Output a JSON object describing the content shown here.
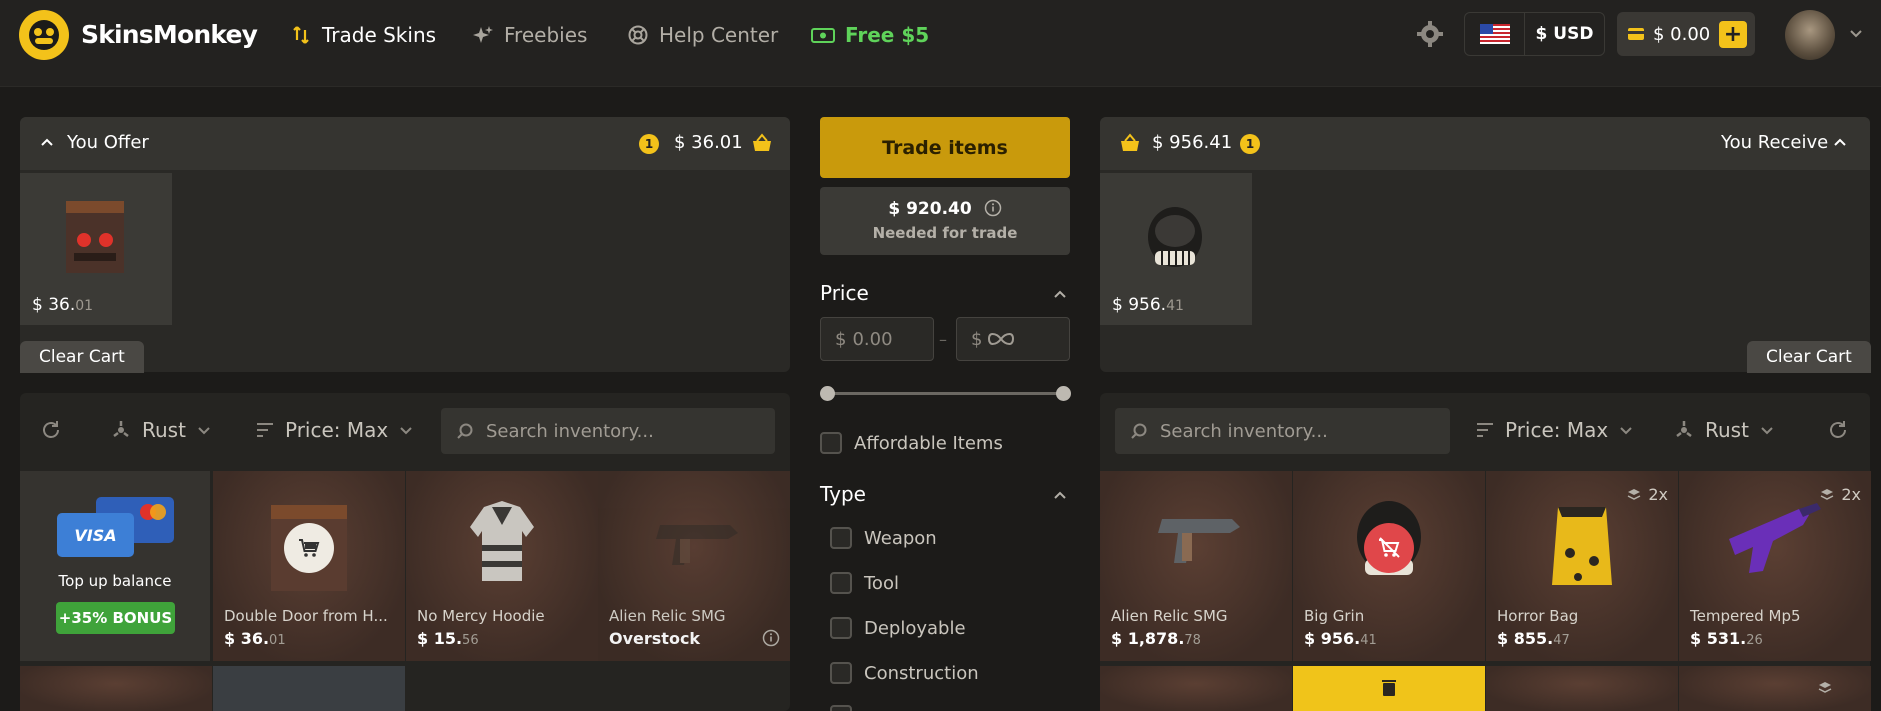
{
  "brand": {
    "name": "SkinsMonkey",
    "accent": "#f3c21a"
  },
  "nav": [
    {
      "label": "Trade Skins",
      "icon": "trade-arrows-icon"
    },
    {
      "label": "Freebies",
      "icon": "sparkles-icon"
    },
    {
      "label": "Help Center",
      "icon": "lifebuoy-icon"
    },
    {
      "label": "Free $5",
      "icon": "cash-icon"
    }
  ],
  "header": {
    "currency": "$ USD",
    "balance": "$ 0.00",
    "add_label": "+"
  },
  "offer": {
    "title": "You Offer",
    "count": "1",
    "total": "$ 36.01",
    "items": [
      {
        "price_main": "$ 36.",
        "price_cents": "01"
      }
    ],
    "clear_label": "Clear Cart"
  },
  "receive": {
    "title": "You Receive",
    "count": "1",
    "total": "$ 956.41",
    "items": [
      {
        "price_main": "$ 956.",
        "price_cents": "41"
      }
    ],
    "clear_label": "Clear Cart"
  },
  "trade": {
    "button_label": "Trade items",
    "needed_value": "$ 920.40",
    "needed_label": "Needed for trade"
  },
  "filters": {
    "price_title": "Price",
    "price_min_symbol": "$",
    "price_min_placeholder": "0.00",
    "price_sep": "–",
    "price_max_symbol": "$",
    "affordable_label": "Affordable Items",
    "type_title": "Type",
    "types": [
      "Weapon",
      "Tool",
      "Deployable",
      "Construction"
    ]
  },
  "left_toolbar": {
    "game": "Rust",
    "sort": "Price: Max",
    "search_placeholder": "Search inventory..."
  },
  "right_toolbar": {
    "search_placeholder": "Search inventory...",
    "sort": "Price: Max",
    "game": "Rust"
  },
  "topup": {
    "label": "Top up balance",
    "card_label": "VISA",
    "bonus": "+35% BONUS"
  },
  "left_items": [
    {
      "name": "Double Door from H...",
      "price_main": "$ 36.",
      "price_cents": "01"
    },
    {
      "name": "No Mercy Hoodie",
      "price_main": "$ 15.",
      "price_cents": "56"
    },
    {
      "name": "Alien Relic SMG",
      "status": "Overstock"
    }
  ],
  "right_items": [
    {
      "name": "Alien Relic SMG",
      "price_main": "$ 1,878.",
      "price_cents": "78"
    },
    {
      "name": "Big Grin",
      "price_main": "$ 956.",
      "price_cents": "41"
    },
    {
      "name": "Horror Bag",
      "price_main": "$ 855.",
      "price_cents": "47",
      "stack": "2x"
    },
    {
      "name": "Tempered Mp5",
      "price_main": "$ 531.",
      "price_cents": "26",
      "stack": "2x"
    }
  ]
}
